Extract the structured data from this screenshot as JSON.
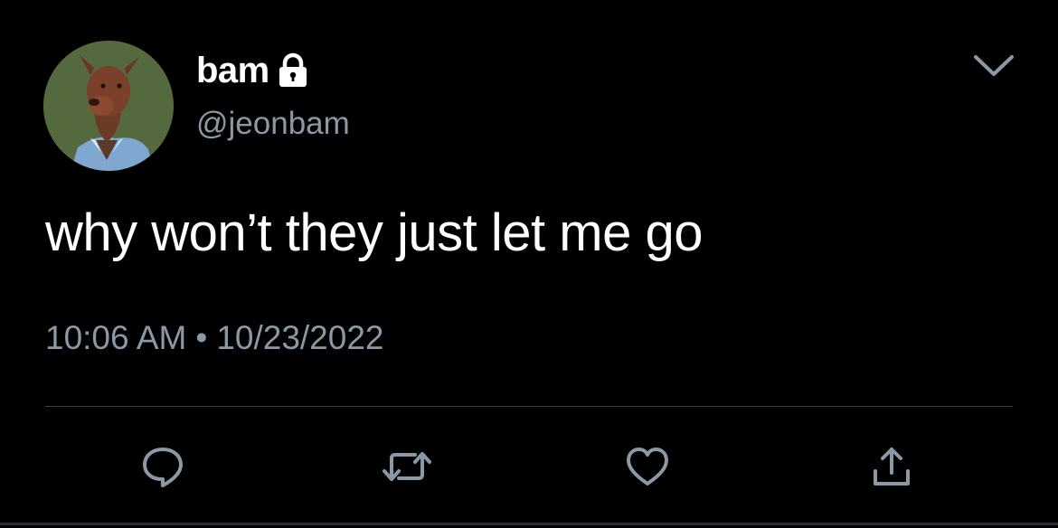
{
  "user": {
    "display_name": "bam",
    "handle": "@jeonbam",
    "protected_icon": "lock-icon",
    "avatar_icon": "dog-avatar"
  },
  "tweet": {
    "text": "why won’t they just let me go",
    "time": "10:06 AM",
    "separator": "•",
    "date": "10/23/2022"
  },
  "actions": [
    {
      "name": "reply",
      "icon": "speech-bubble-icon"
    },
    {
      "name": "retweet",
      "icon": "retweet-arrows-icon"
    },
    {
      "name": "like",
      "icon": "heart-icon"
    },
    {
      "name": "share",
      "icon": "share-upload-icon"
    }
  ],
  "menu_icon": "chevron-down-icon",
  "colors": {
    "background": "#000000",
    "primary_text": "#ffffff",
    "secondary_text": "#8b98a5",
    "divider": "#3a3f44"
  }
}
